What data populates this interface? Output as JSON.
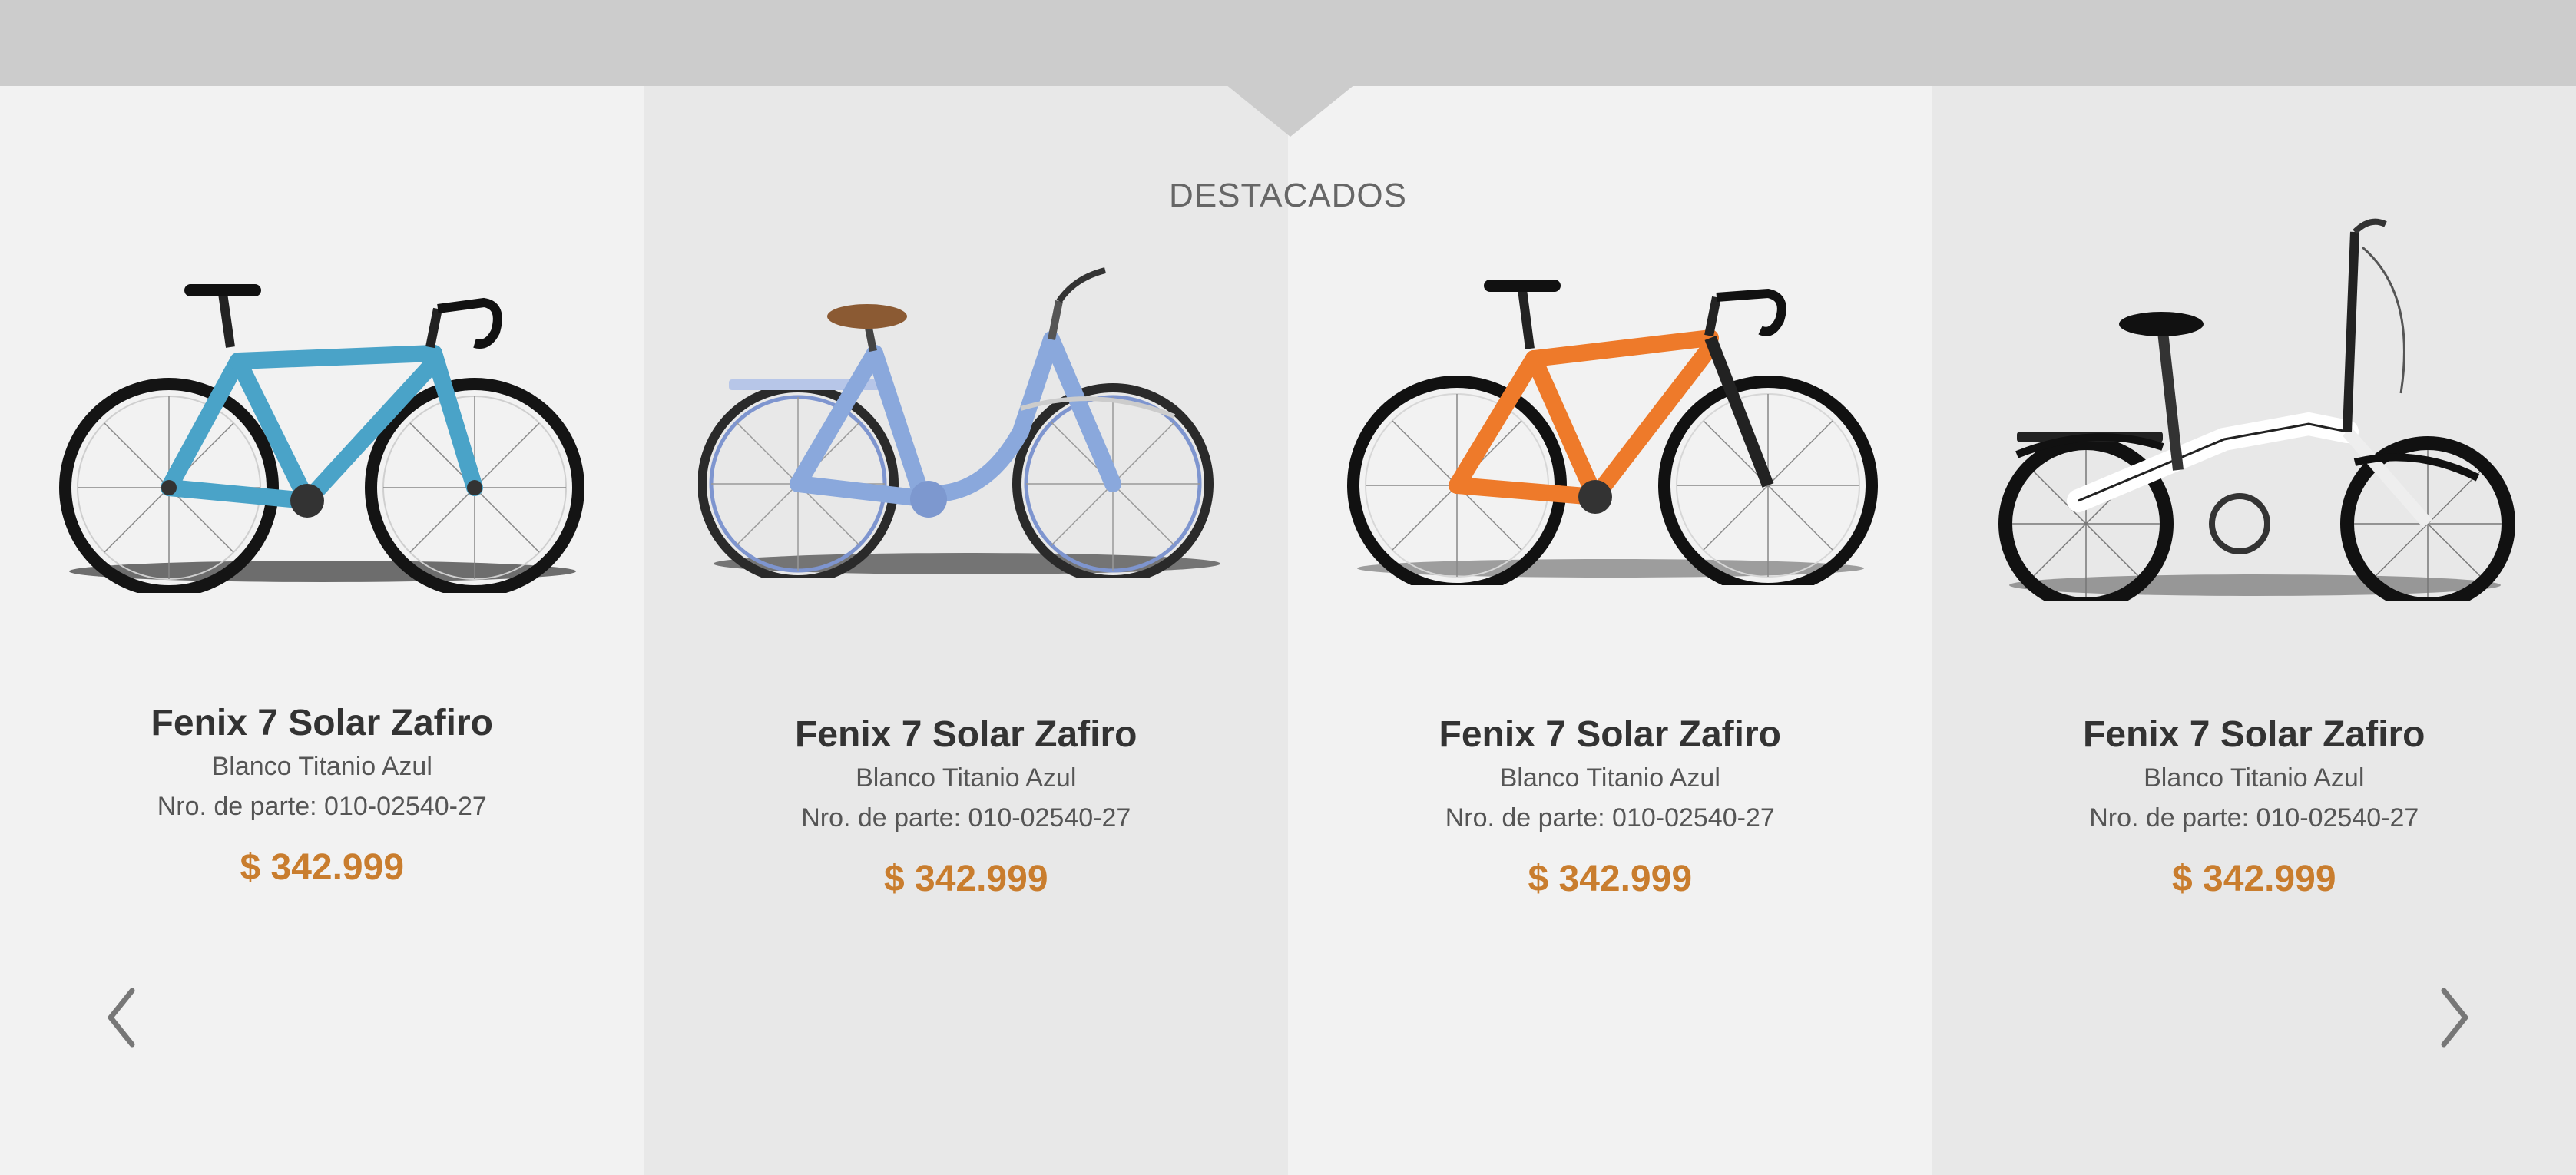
{
  "section": {
    "title": "DESTACADOS"
  },
  "colors": {
    "price": "#c97d2e",
    "band": "#cccccc",
    "col_light": "#f2f2f2",
    "col_dark": "#e8e8e8"
  },
  "products": [
    {
      "name": "Fenix 7 Solar Zafiro",
      "variant": "Blanco Titanio Azul",
      "part": "Nro. de parte: 010-02540-27",
      "price": "$ 342.999",
      "frame_color": "#4aa3c8",
      "bike_type": "road"
    },
    {
      "name": "Fenix 7 Solar Zafiro",
      "variant": "Blanco Titanio Azul",
      "part": "Nro. de parte: 010-02540-27",
      "price": "$ 342.999",
      "frame_color": "#8aa8dc",
      "bike_type": "city"
    },
    {
      "name": "Fenix 7 Solar Zafiro",
      "variant": "Blanco Titanio Azul",
      "part": "Nro. de parte: 010-02540-27",
      "price": "$ 342.999",
      "frame_color": "#ee7a2a",
      "bike_type": "road"
    },
    {
      "name": "Fenix 7 Solar Zafiro",
      "variant": "Blanco Titanio Azul",
      "part": "Nro. de parte: 010-02540-27",
      "price": "$ 342.999",
      "frame_color": "#ffffff",
      "bike_type": "folding"
    }
  ],
  "nav": {
    "prev_icon": "chevron-left-icon",
    "next_icon": "chevron-right-icon"
  }
}
